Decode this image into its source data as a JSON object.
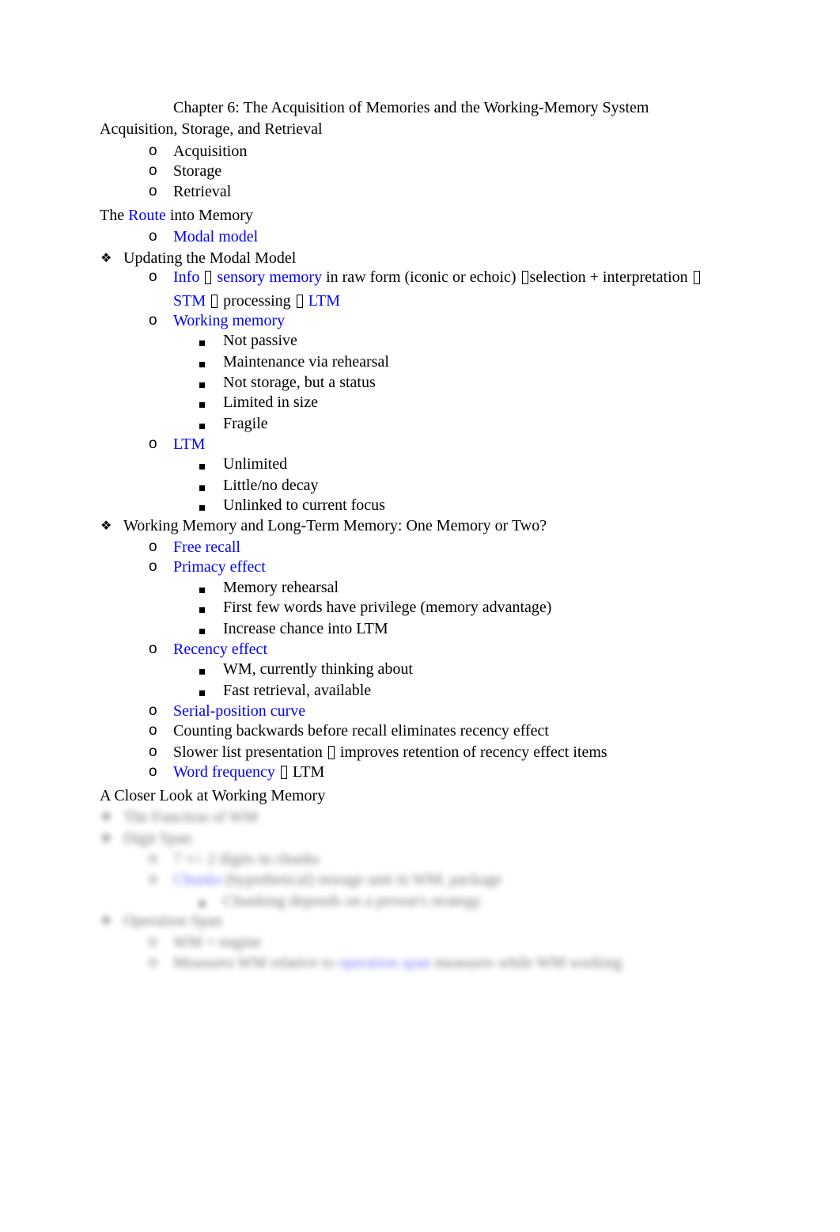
{
  "document": {
    "title": "Chapter 6: The Acquisition of Memories and the Working-Memory System",
    "link_color": "#0000ff",
    "sections": {
      "acs": {
        "heading": "Acquisition, Storage, and Retrieval",
        "items": [
          "Acquisition",
          "Storage",
          "Retrieval"
        ]
      },
      "route": {
        "heading_pre": "The",
        "heading_link": "Route",
        "heading_post": "into Memory",
        "items": [
          {
            "text": "Modal model",
            "link": true
          }
        ]
      },
      "updating": {
        "heading": "Updating the Modal Model",
        "bullet_icon": "four-diamond-bullet",
        "info_line": {
          "parts": [
            "Info",
            "sensory memory",
            "in raw form (iconic or echoic)",
            "selection + interpretation",
            "STM",
            "processing",
            "LTM"
          ],
          "arrow_glyph": "missing-glyph-box"
        },
        "working_memory": {
          "label": "Working memory",
          "items": [
            "Not passive",
            "Maintenance via rehearsal",
            "Not storage, but a status",
            "Limited in size",
            "Fragile"
          ]
        },
        "ltm": {
          "label": "LTM",
          "items": [
            "Unlimited",
            "Little/no decay",
            "Unlinked to current focus"
          ]
        }
      },
      "one_or_two": {
        "heading": "Working Memory and Long-Term Memory: One Memory or Two?",
        "free_recall": "Free recall",
        "primacy": {
          "label": "Primacy effect",
          "items": [
            "Memory rehearsal",
            "First few words have privilege (memory advantage)",
            "Increase chance into LTM"
          ]
        },
        "recency": {
          "label": "Recency effect",
          "items": [
            "WM, currently thinking about",
            "Fast retrieval, available"
          ]
        },
        "serial_position": "Serial-position curve",
        "counting_backwards": "Counting backwards before recall eliminates recency effect",
        "slower_list_pre": "Slower list presentation",
        "slower_list_post": "improves retention of recency effect items",
        "word_frequency": "Word frequency",
        "word_frequency_post": "LTM"
      },
      "closer_look": {
        "heading": "A Closer Look at Working Memory"
      }
    },
    "blurred_preview": {
      "note": "Content below is obscured (blurred preview)",
      "lines": [
        "The Function of WM",
        "Digit Span",
        "7 +/- 2 digits in chunks",
        "Chunks",
        "(hypothetical) storage unit in WM; package",
        "Chunking depends on a person's strategy",
        "Operation Span",
        "WM = engine",
        "Measures WM relative to",
        "operation span",
        "measures while WM working"
      ]
    }
  }
}
